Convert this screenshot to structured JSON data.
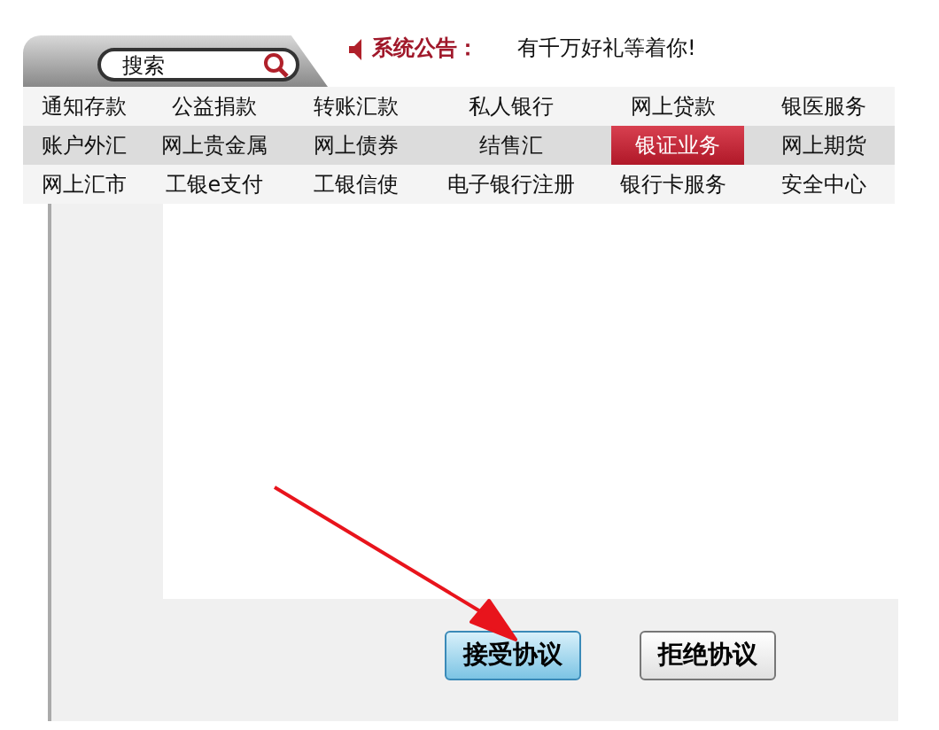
{
  "search": {
    "placeholder": "搜索"
  },
  "notice": {
    "label": "系统公告：",
    "text": "有千万好礼等着你!"
  },
  "menu": [
    [
      {
        "label": "通知存款",
        "selected": false
      },
      {
        "label": "公益捐款",
        "selected": false
      },
      {
        "label": "转账汇款",
        "selected": false
      },
      {
        "label": "私人银行",
        "selected": false
      },
      {
        "label": "网上贷款",
        "selected": false
      },
      {
        "label": "银医服务",
        "selected": false
      }
    ],
    [
      {
        "label": "账户外汇",
        "selected": false
      },
      {
        "label": "网上贵金属",
        "selected": false
      },
      {
        "label": "网上债券",
        "selected": false
      },
      {
        "label": "结售汇",
        "selected": false
      },
      {
        "label": "银证业务",
        "selected": true
      },
      {
        "label": "网上期货",
        "selected": false
      }
    ],
    [
      {
        "label": "网上汇市",
        "selected": false
      },
      {
        "label": "工银e支付",
        "selected": false
      },
      {
        "label": "工银信使",
        "selected": false
      },
      {
        "label": "电子银行注册",
        "selected": false
      },
      {
        "label": "银行卡服务",
        "selected": false
      },
      {
        "label": "安全中心",
        "selected": false
      }
    ]
  ],
  "buttons": [
    {
      "label": "接受协议",
      "kind": "primary"
    },
    {
      "label": "拒绝协议",
      "kind": "default"
    }
  ]
}
